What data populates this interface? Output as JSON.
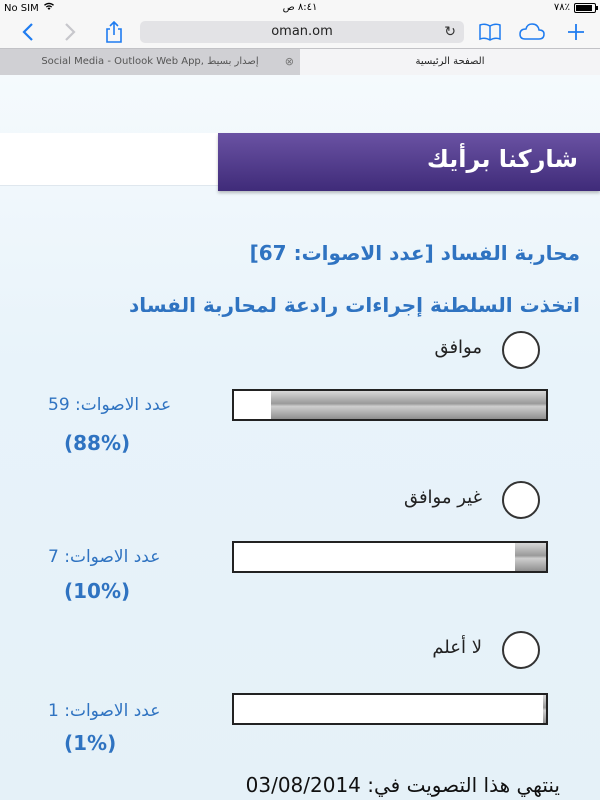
{
  "status_bar": {
    "carrier": "No SIM",
    "time": "٨:٤١ ص",
    "battery": "٧٨٪"
  },
  "toolbar": {
    "back": "‹",
    "forward": "›",
    "url": "oman.om",
    "reload_icon": "reload-icon"
  },
  "tabs": [
    {
      "label": "Social Media - Outlook Web App, إصدار بسيط"
    },
    {
      "label": "الصفحة الرئيسية"
    }
  ],
  "header": {
    "title": "شاركنا برأيك"
  },
  "poll": {
    "title": "محاربة الفساد [عدد الاصوات: 67]",
    "question": "اتخذت السلطنة إجراءات رادعة لمحاربة الفساد",
    "options": [
      {
        "label": "موافق",
        "votes": "عدد الاصوات: 59",
        "percent_text": "(88%)",
        "percent": 88
      },
      {
        "label": "غير موافق",
        "votes": "عدد الاصوات: 7",
        "percent_text": "(10%)",
        "percent": 10
      },
      {
        "label": "لا أعلم",
        "votes": "عدد الاصوات: 1",
        "percent_text": "(1%)",
        "percent": 1
      }
    ],
    "end_text": "ينتهي هذا التصويت في: 03/08/2014"
  },
  "colors": {
    "accent_blue": "#2f73c1",
    "header_purple": "#4b3487",
    "ios_blue": "#1f7cf0"
  }
}
